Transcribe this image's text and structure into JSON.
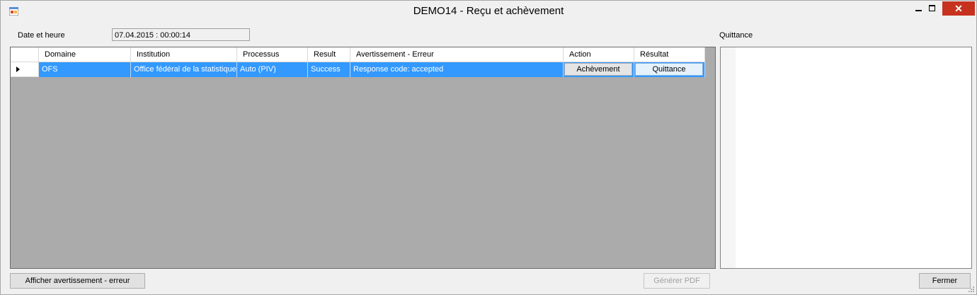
{
  "window": {
    "title": "DEMO14 - Reçu et achèvement"
  },
  "controls": {
    "close_glyph": "✕"
  },
  "form": {
    "datetime_label": "Date et heure",
    "datetime_value": "07.04.2015 : 00:00:14",
    "quittance_label": "Quittance"
  },
  "grid": {
    "columns": [
      "Domaine",
      "Institution",
      "Processus",
      "Result",
      "Avertissement - Erreur",
      "Action",
      "Résultat"
    ],
    "rows": [
      {
        "domaine": "OFS",
        "institution": "Office fédéral de la statistique",
        "processus": "Auto (PIV)",
        "result": "Success",
        "avertissement": "Response code: accepted",
        "action_button": "Achèvement",
        "resultat_button": "Quittance"
      }
    ]
  },
  "buttons": {
    "show_warning": "Afficher avertissement - erreur",
    "generate_pdf": "Générer PDF",
    "close": "Fermer"
  },
  "colors": {
    "selection": "#3399ff",
    "grid_background": "#ababab",
    "close_button": "#c7321f"
  }
}
